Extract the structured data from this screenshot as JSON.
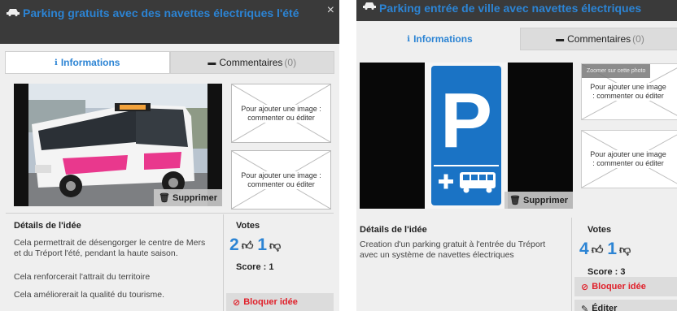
{
  "panel1": {
    "title": "Parking gratuits avec des navettes électriques l'été",
    "close_label": "×",
    "tabs": {
      "info_label": "Informations",
      "comments_label": "Commentaires",
      "comments_count": "(0)"
    },
    "photo_delete_label": "Supprimer",
    "placeholder_text": "Pour ajouter une image : commenter ou éditer",
    "details_title": "Détails de l'idée",
    "details": [
      "Cela permettrait de désengorger le centre de Mers et du Tréport l'été, pendant la haute saison.",
      "Cela renforcerait l'attrait du territoire",
      "Cela améliorerait la qualité du tourisme."
    ],
    "votes_title": "Votes",
    "votes_up": "2",
    "votes_down": "1",
    "score": "Score : 1",
    "block_label": "Bloquer idée"
  },
  "panel2": {
    "title": "Parking entrée de ville avec navettes électriques",
    "tabs": {
      "info_label": "Informations",
      "comments_label": "Commentaires",
      "comments_count": "(0)"
    },
    "zoom_label": "Zoomer sur cette photo",
    "photo_delete_label": "Supprimer",
    "placeholder_text": "Pour ajouter une image : commenter ou éditer",
    "details_title": "Détails de l'idée",
    "details": "Creation d'un parking gratuit à l'entrée du Tréport avec un système de navettes électriques",
    "votes_title": "Votes",
    "votes_up": "4",
    "votes_down": "1",
    "score": "Score : 3",
    "block_label": "Bloquer idée",
    "edit_label": "Éditer"
  },
  "colors": {
    "accent": "#2c84d4",
    "header_bg": "#3a3a3a",
    "danger": "#e0202a",
    "sign_blue": "#1a73c5"
  }
}
